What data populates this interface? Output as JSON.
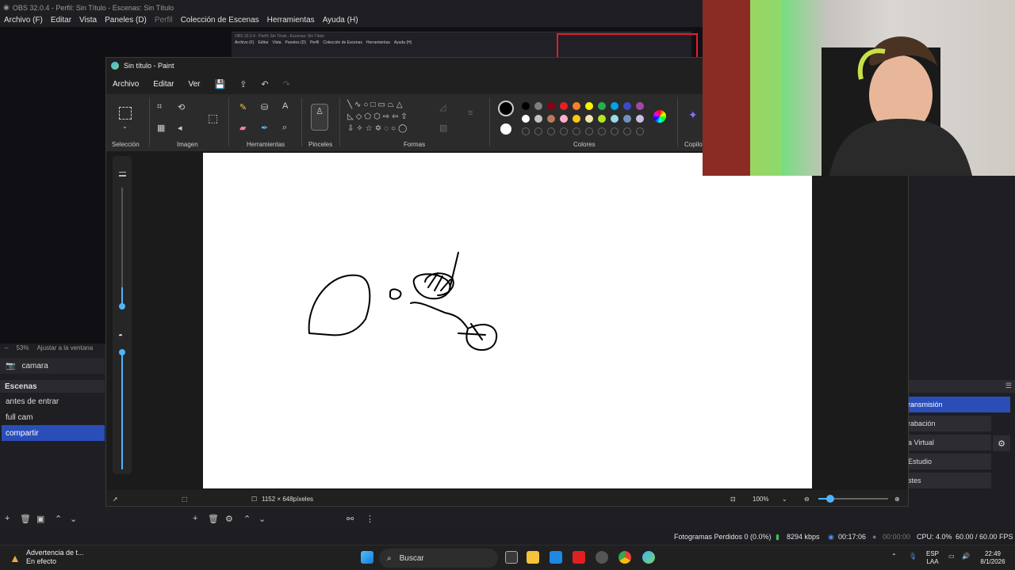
{
  "obs": {
    "title": "OBS 32.0.4 - Perfil: Sin Título - Escenas: Sin Título",
    "menu": [
      "Archivo (F)",
      "Editar",
      "Vista",
      "Paneles (D)",
      "Perfil",
      "Colección de Escenas",
      "Herramientas",
      "Ayuda (H)"
    ],
    "nested_title": "OBS 32.0.4 - Perfil: Sin Título - Escenas: Sin Título",
    "nested_menu": [
      "Archivo (F)",
      "Editar",
      "Vista",
      "Paneles (D)",
      "Perfil",
      "Colección de Escenas",
      "Herramientas",
      "Ayuda (H)"
    ],
    "zoom": "53%",
    "fit_label": "Ajustar a la ventana",
    "source": "camara",
    "scenes_header": "Escenas",
    "scenes": [
      "antes de entrar",
      "full cam",
      "compartir"
    ],
    "selected_scene": "compartir",
    "controls": [
      "ransmisión",
      "rabación",
      "a Virtual",
      "Estudio",
      "stes"
    ],
    "status": {
      "dropped": "Fotogramas Perdidos 0 (0.0%)",
      "kbps": "8294 kbps",
      "stream_time": "00:17:06",
      "rec_time": "00:00:00",
      "cpu": "CPU: 4.0%",
      "fps": "60.00 / 60.00 FPS"
    }
  },
  "paint": {
    "title": "Sin título - Paint",
    "menu": [
      "Archivo",
      "Editar",
      "Ver"
    ],
    "groups": [
      "Selección",
      "Imagen",
      "Herramientas",
      "Pinceles",
      "Formas",
      "Colores",
      "Copilo"
    ],
    "canvas_size": "1152 × 648píxeles",
    "zoom": "100%",
    "colors": {
      "row1": [
        "#000000",
        "#7f7f7f",
        "#880015",
        "#ed1c24",
        "#ff7f27",
        "#fff200",
        "#22b14c",
        "#00a2e8",
        "#3f48cc",
        "#a349a4"
      ],
      "row2": [
        "#ffffff",
        "#c3c3c3",
        "#b97a57",
        "#ffaec9",
        "#ffc90e",
        "#efe4b0",
        "#b5e61d",
        "#99d9ea",
        "#7092be",
        "#c8bfe7"
      ]
    }
  },
  "taskbar": {
    "notification_title": "Advertencia de t...",
    "notification_sub": "En efecto",
    "search": "Buscar",
    "lang": "ESP",
    "lang_sub": "LAA",
    "time": "22:49",
    "date": "8/1/2026"
  }
}
